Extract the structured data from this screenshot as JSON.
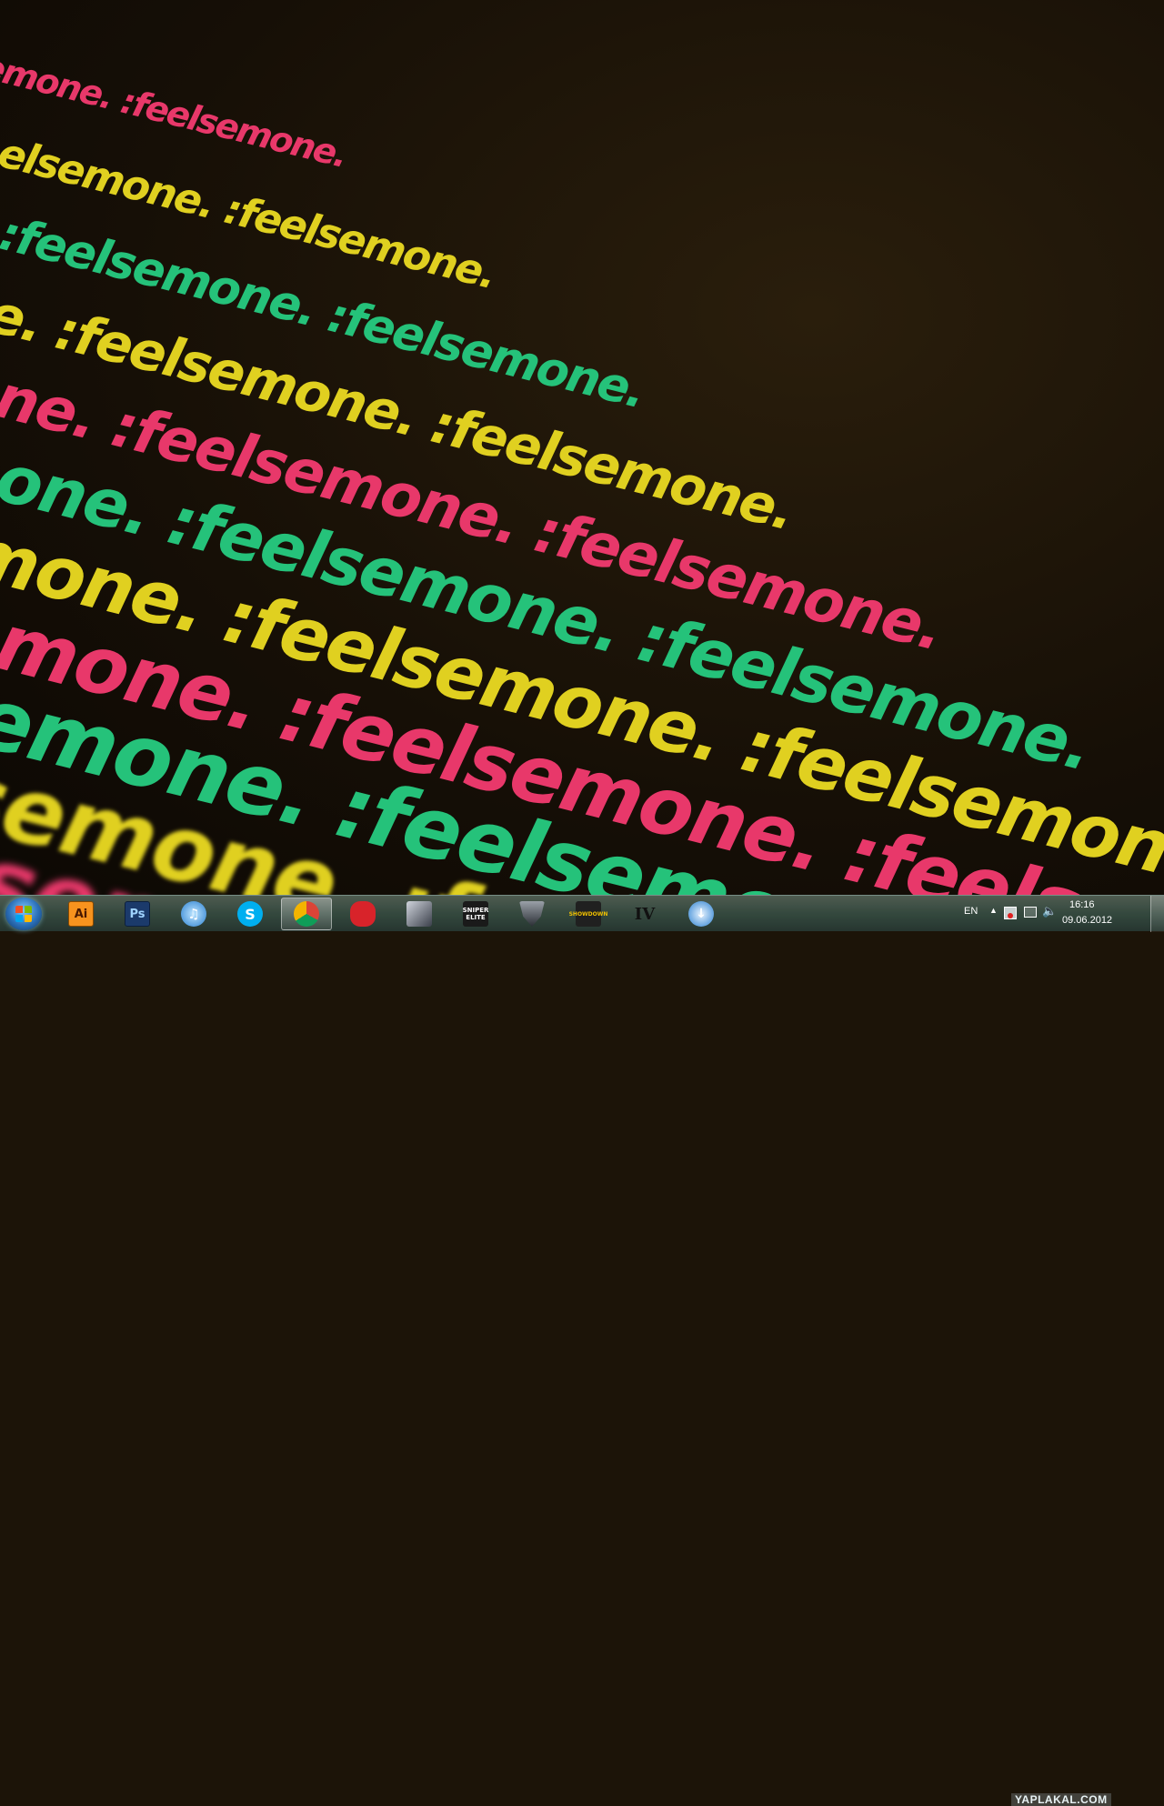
{
  "wallpaper": {
    "word": ":feelsemone.",
    "colors": {
      "pink": "#e8386a",
      "green": "#25c27a",
      "yellow": "#e0d020"
    }
  },
  "taskbar": {
    "start_label": "",
    "apps": [
      {
        "name": "illustrator",
        "label": "Ai",
        "icon": "adobe-illustrator-icon",
        "active": false
      },
      {
        "name": "photoshop",
        "label": "Ps",
        "icon": "adobe-photoshop-icon",
        "active": false
      },
      {
        "name": "itunes",
        "label": "♫",
        "icon": "itunes-icon",
        "active": false
      },
      {
        "name": "skype",
        "label": "S",
        "icon": "skype-icon",
        "active": false
      },
      {
        "name": "chrome",
        "label": "",
        "icon": "chrome-icon",
        "active": true
      },
      {
        "name": "angry-birds",
        "label": "",
        "icon": "angry-birds-icon",
        "active": false
      },
      {
        "name": "game-mask",
        "label": "",
        "icon": "game-icon",
        "active": false
      },
      {
        "name": "sniper-elite",
        "label": "SNIPER ELITE",
        "icon": "sniper-elite-icon",
        "active": false
      },
      {
        "name": "warframe",
        "label": "",
        "icon": "game-emblem-icon",
        "active": false
      },
      {
        "name": "showdown",
        "label": "SHOWDOWN",
        "icon": "showdown-icon",
        "active": false
      },
      {
        "name": "gta-iv",
        "label": "IV",
        "icon": "gta-iv-icon",
        "active": false
      },
      {
        "name": "downloader",
        "label": "",
        "icon": "download-icon",
        "active": false
      }
    ]
  },
  "tray": {
    "language": "EN",
    "time": "16:16",
    "date": "09.06.2012"
  },
  "watermark": "YAPLAKAL.COM"
}
